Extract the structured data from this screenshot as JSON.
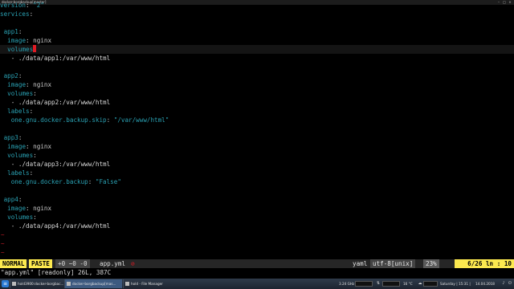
{
  "window": {
    "title": "docker-borgbackup[master]",
    "min": "–",
    "max": "□",
    "close": "×"
  },
  "editor": {
    "lines": [
      {
        "indent": "",
        "key": "version",
        "sep": ": ",
        "val": "\"2\"",
        "vtype": "s"
      },
      {
        "indent": "",
        "key": "services",
        "sep": ":",
        "val": "",
        "vtype": "v"
      },
      {
        "indent": "",
        "key": "",
        "sep": "",
        "val": "",
        "vtype": "v"
      },
      {
        "indent": " ",
        "key": "app1",
        "sep": ":",
        "val": "",
        "vtype": "v"
      },
      {
        "indent": "  ",
        "key": "image",
        "sep": ": ",
        "val": "nginx",
        "vtype": "v"
      },
      {
        "indent": "  ",
        "key": "volumes",
        "sep": "",
        "val": "",
        "vtype": "v",
        "cursor": true
      },
      {
        "indent": "   ",
        "key": "",
        "sep": "- ",
        "val": "./data/app1:/var/www/html",
        "vtype": "d"
      },
      {
        "indent": "",
        "key": "",
        "sep": "",
        "val": "",
        "vtype": "v"
      },
      {
        "indent": " ",
        "key": "app2",
        "sep": ":",
        "val": "",
        "vtype": "v"
      },
      {
        "indent": "  ",
        "key": "image",
        "sep": ": ",
        "val": "nginx",
        "vtype": "v"
      },
      {
        "indent": "  ",
        "key": "volumes",
        "sep": ":",
        "val": "",
        "vtype": "v"
      },
      {
        "indent": "   ",
        "key": "",
        "sep": "- ",
        "val": "./data/app2:/var/www/html",
        "vtype": "d"
      },
      {
        "indent": "  ",
        "key": "labels",
        "sep": ":",
        "val": "",
        "vtype": "v"
      },
      {
        "indent": "   ",
        "key": "one.gnu.docker.backup.skip",
        "sep": ": ",
        "val": "\"/var/www/html\"",
        "vtype": "s"
      },
      {
        "indent": "",
        "key": "",
        "sep": "",
        "val": "",
        "vtype": "v"
      },
      {
        "indent": " ",
        "key": "app3",
        "sep": ":",
        "val": "",
        "vtype": "v"
      },
      {
        "indent": "  ",
        "key": "image",
        "sep": ": ",
        "val": "nginx",
        "vtype": "v"
      },
      {
        "indent": "  ",
        "key": "volumes",
        "sep": ":",
        "val": "",
        "vtype": "v"
      },
      {
        "indent": "   ",
        "key": "",
        "sep": "- ",
        "val": "./data/app3:/var/www/html",
        "vtype": "d"
      },
      {
        "indent": "  ",
        "key": "labels",
        "sep": ":",
        "val": "",
        "vtype": "v"
      },
      {
        "indent": "   ",
        "key": "one.gnu.docker.backup",
        "sep": ": ",
        "val": "\"False\"",
        "vtype": "s"
      },
      {
        "indent": "",
        "key": "",
        "sep": "",
        "val": "",
        "vtype": "v"
      },
      {
        "indent": " ",
        "key": "app4",
        "sep": ":",
        "val": "",
        "vtype": "v"
      },
      {
        "indent": "  ",
        "key": "image",
        "sep": ": ",
        "val": "nginx",
        "vtype": "v"
      },
      {
        "indent": "  ",
        "key": "volumes",
        "sep": ":",
        "val": "",
        "vtype": "v"
      },
      {
        "indent": "   ",
        "key": "",
        "sep": "- ",
        "val": "./data/app4:/var/www/html",
        "vtype": "d"
      }
    ],
    "tilde": "~"
  },
  "statusline": {
    "mode": "NORMAL",
    "paste": "PASTE",
    "diff": "+0 ~0 -0",
    "filename": "app.yml",
    "modified": "⊘",
    "filetype": "yaml",
    "encoding": "utf-8[unix]",
    "percent": "23%",
    "position": "6/26 ln : 10"
  },
  "cmdline": {
    "text": "\"app.yml\" [readonly] 26L, 387C"
  },
  "taskbar": {
    "menu_icon": "≡",
    "tasks": [
      {
        "label": "hold3900:docker-borgbac..."
      },
      {
        "label": "docker-borgbackup[mas..."
      },
      {
        "label": "hold - File Manager"
      }
    ],
    "cpu": "3.24 GHz",
    "temp": "16 °C",
    "date": "Saturday | 15:31 |",
    "date2": "14.04.2018"
  }
}
